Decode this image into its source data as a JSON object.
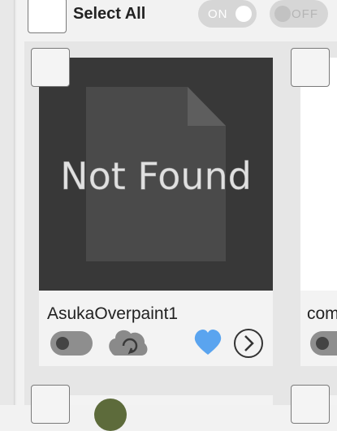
{
  "header": {
    "select_all_label": "Select All",
    "on_label": "ON",
    "off_label": "OFF"
  },
  "items": [
    {
      "title": "AsukaOverpaint1",
      "thumbnail_text": "Not Found",
      "favorite_color": "#5aa4ef"
    },
    {
      "title": "com"
    }
  ],
  "icons": {
    "cloud": "cloud-sync-icon",
    "heart": "heart-icon",
    "chevron": "chevron-right-icon"
  },
  "colors": {
    "accent_heart": "#5aa4ef",
    "thumbnail_bg": "#383838"
  }
}
